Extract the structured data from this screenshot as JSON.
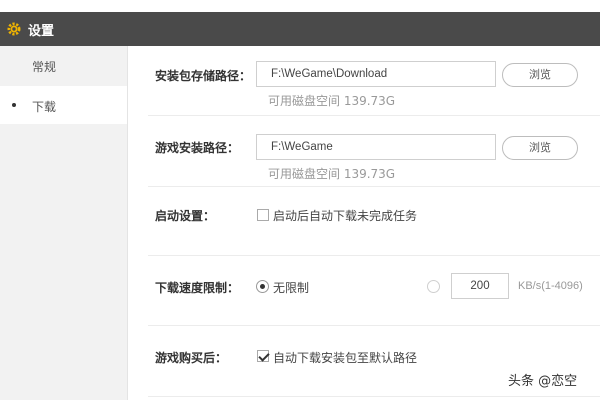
{
  "window": {
    "title": "设置",
    "icon": "gear-icon",
    "accent": "#f0b400"
  },
  "sidebar": {
    "items": [
      {
        "label": "常规",
        "active": false
      },
      {
        "label": "下载",
        "active": true
      }
    ]
  },
  "download": {
    "package_path": {
      "label": "安装包存储路径：",
      "value": "F:\\WeGame\\Download",
      "browse_label": "浏览",
      "space_text": "可用磁盘空间 139.73G"
    },
    "game_path": {
      "label": "游戏安装路径：",
      "value": "F:\\WeGame",
      "browse_label": "浏览",
      "space_text": "可用磁盘空间 139.73G"
    },
    "startup": {
      "label": "启动设置：",
      "option_label": "启动后自动下载未完成任务",
      "checked": false
    },
    "speed_limit": {
      "label": "下载速度限制：",
      "unlimited_label": "无限制",
      "unlimited_selected": true,
      "limit_value": "200",
      "unit": "KB/s(1-4096)"
    },
    "after_purchase": {
      "label": "游戏购买后：",
      "option_label": "自动下载安装包至默认路径",
      "checked": true
    }
  },
  "watermark": "头条 @恋空"
}
